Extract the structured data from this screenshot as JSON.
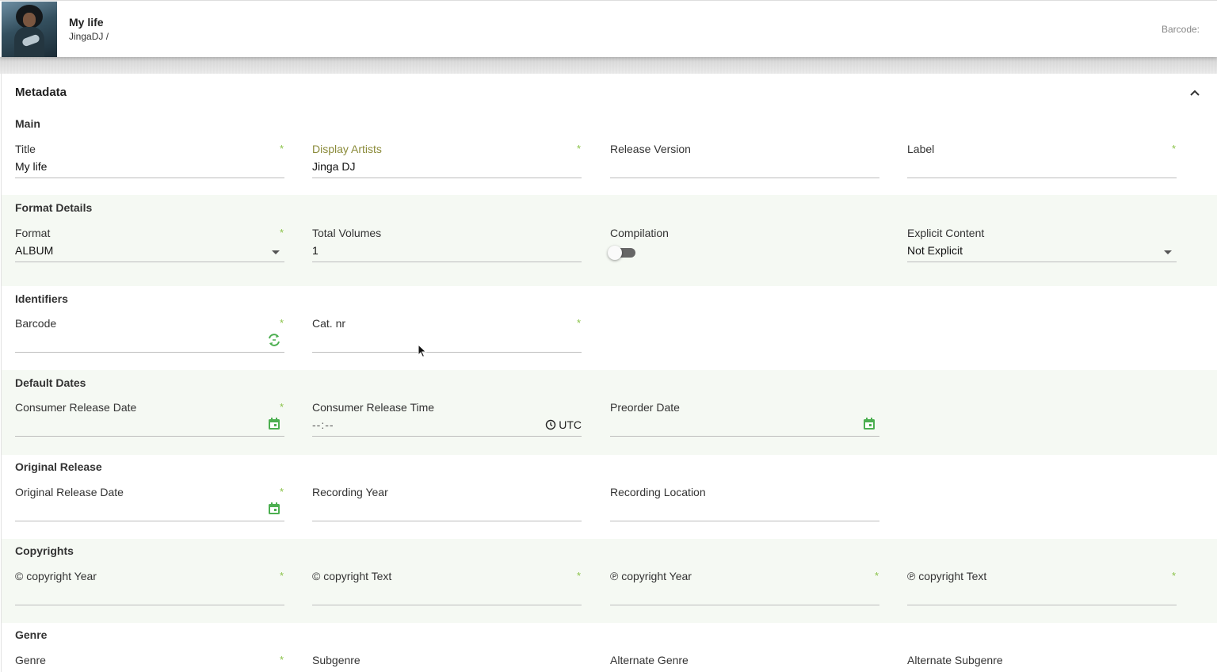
{
  "header": {
    "title": "My life",
    "subtitle": "JingaDJ /",
    "barcode_label": "Barcode:"
  },
  "panel": {
    "title": "Metadata"
  },
  "sections": {
    "main": {
      "title": "Main",
      "title_field": {
        "label": "Title",
        "value": "My life",
        "required": "*"
      },
      "display_artists": {
        "label": "Display Artists",
        "value": "Jinga DJ",
        "required": "*"
      },
      "release_version": {
        "label": "Release Version",
        "value": ""
      },
      "label": {
        "label": "Label",
        "value": "",
        "required": "*"
      }
    },
    "format": {
      "title": "Format Details",
      "format": {
        "label": "Format",
        "value": "ALBUM",
        "required": "*"
      },
      "total_volumes": {
        "label": "Total Volumes",
        "value": "1"
      },
      "compilation": {
        "label": "Compilation",
        "checked": false
      },
      "explicit": {
        "label": "Explicit Content",
        "value": "Not Explicit"
      }
    },
    "identifiers": {
      "title": "Identifiers",
      "barcode": {
        "label": "Barcode",
        "value": "",
        "required": "*"
      },
      "cat_nr": {
        "label": "Cat. nr",
        "value": "",
        "required": "*"
      }
    },
    "dates": {
      "title": "Default Dates",
      "consumer_release_date": {
        "label": "Consumer Release Date",
        "value": "",
        "required": "*"
      },
      "consumer_release_time": {
        "label": "Consumer Release Time",
        "value": "--:--",
        "timezone": "UTC"
      },
      "preorder_date": {
        "label": "Preorder Date",
        "value": ""
      }
    },
    "original": {
      "title": "Original Release",
      "original_release_date": {
        "label": "Original Release Date",
        "value": "",
        "required": "*"
      },
      "recording_year": {
        "label": "Recording Year",
        "value": ""
      },
      "recording_location": {
        "label": "Recording Location",
        "value": ""
      }
    },
    "copyrights": {
      "title": "Copyrights",
      "c_year": {
        "label": "© copyright Year",
        "value": "",
        "required": "*"
      },
      "c_text": {
        "label": "© copyright Text",
        "value": "",
        "required": "*"
      },
      "p_year": {
        "label": "℗ copyright Year",
        "value": "",
        "required": "*"
      },
      "p_text": {
        "label": "℗ copyright Text",
        "value": "",
        "required": "*"
      }
    },
    "genre": {
      "title": "Genre",
      "genre": {
        "label": "Genre",
        "value": "",
        "required": "*"
      },
      "subgenre": {
        "label": "Subgenre",
        "value": ""
      },
      "alt_genre": {
        "label": "Alternate Genre",
        "value": ""
      },
      "alt_subgenre": {
        "label": "Alternate Subgenre",
        "value": ""
      }
    }
  },
  "colors": {
    "accent_green": "#4caf50",
    "required_mark": "#8bc34a",
    "section_tint": "#f5f9f3",
    "display_artists_label": "#8b8b3a"
  },
  "icons": {
    "collapse": "chevron-up-icon",
    "barcode_generate": "refresh-icon",
    "date": "calendar-icon",
    "time": "clock-icon",
    "dropdown": "caret-down-icon"
  }
}
